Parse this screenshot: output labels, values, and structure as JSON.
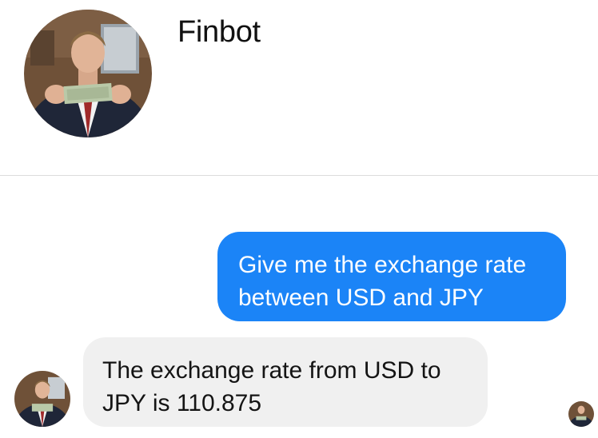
{
  "header": {
    "bot_name": "Finbot",
    "avatar_icon": "profile-photo-man-holding-banknote"
  },
  "messages": [
    {
      "sender": "user",
      "lines": [
        "Give me the exchange rate",
        "between USD and JPY"
      ]
    },
    {
      "sender": "bot",
      "lines": [
        "The exchange rate from USD to",
        "JPY is 110.875"
      ]
    }
  ],
  "colors": {
    "outgoing_bubble": "#1b84f7",
    "incoming_bubble": "#f0f0f0",
    "divider": "#dcdcdc",
    "text": "#141414"
  }
}
